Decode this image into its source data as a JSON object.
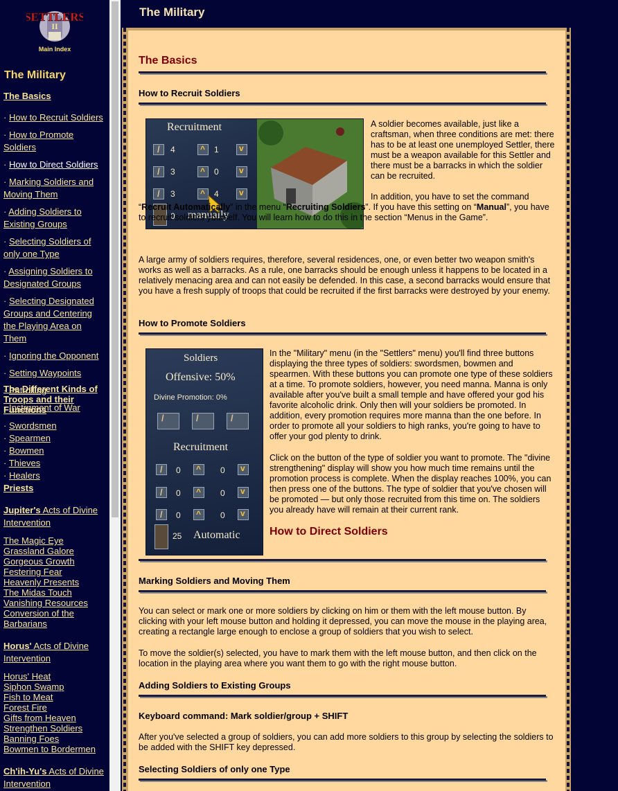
{
  "sidebar": {
    "logo_caption": "Main Index",
    "title": "The Military",
    "basics": "The Basics",
    "basics_items": [
      "How to Recruit Soldiers",
      "How to Promote Soldiers",
      "How to Direct Soldiers",
      "Marking Soldiers and Moving Them",
      "Adding Soldiers to Existing Groups",
      "Selecting Soldiers of only one Type",
      "Assigning Soldiers to Designated Groups",
      "Selecting Designated Groups and Centering the Playing Area on Them",
      "Ignoring the Opponent",
      "Setting Waypoints",
      "Patrolling",
      "Instrument of War"
    ],
    "kinds": "The Different Kinds of Troops and their Functions",
    "kinds_items": [
      "Swordsmen",
      "Spearmen",
      "Bowmen",
      "Thieves",
      "Healers"
    ],
    "priests": "Priests",
    "jupiter_bold": "Jupiter's",
    "jupiter_rest": " Acts of Divine Intervention",
    "jupiter_items": [
      "The Magic Eye",
      "Grassland Galore",
      "Gorgeous Growth",
      "Festering Fear",
      "Heavenly Presents",
      "The Midas Touch",
      "Vanishing Resources",
      "Conversion of the Barbarians"
    ],
    "horus_bold": "Horus'",
    "horus_rest": " Acts of Divine Intervention",
    "horus_items": [
      "Horus' Heat",
      "Siphon Swamp",
      "Fish to Meat",
      "Forest Fire",
      "Gifts from Heaven",
      "Strengthen Soldiers",
      "Banning Foes",
      "Bowmen to Bordermen"
    ],
    "chihyu_bold": "Ch'ih-Yu's",
    "chihyu_rest": " Acts of Divine Intervention"
  },
  "header": {
    "title": "The Military"
  },
  "main": {
    "basics_heading": "The Basics",
    "recruit_heading": "How to Recruit Soldiers",
    "recruit_p1": "A soldier becomes available, just like a craftsman, when three conditions are met: there has to be at least one unemployed Settler, there must be a weapon available for this Settler and there must be a barracks in which the soldier can be recruited.",
    "recruit_p2a": "In addition, you have to set the command “",
    "recruit_p2b": "Recruit Automatically",
    "recruit_p2c": "” in the menu “",
    "recruit_p2d": "Recruiting Soldiers",
    "recruit_p2e": "”. If you have this setting on “",
    "recruit_p2f": "Manual",
    "recruit_p2g": "”, you have to recruit soldiers yourself. You will learn how to do this in the section “Menus in the Game”.",
    "recruit_p3": "A large army of soldiers requires, therefore, several residences, one, or even better two weapon smith's works as well as a barracks. As a rule, one barracks should be enough unless it happens to be located in a relatively menacing area and can not easily be defended. In this case, a second barracks would ensure that you have a fresh supply of troops that could be recruited if the first barracks were destroyed by your enemy.",
    "promote_heading": "How to Promote Soldiers",
    "promote_p1": "In the \"Military\" menu (in the \"Settlers\" menu) you'll find three buttons displaying the three types of soldiers: swordsmen, bowmen and spearmen. With these buttons you can promote one type of these soldiers at a time. To promote soldiers, however, you need manna. Manna is only available after you've built a small temple and have offered your god his favorite alcoholic drink. Only then will your soldiers be promoted. In addition, every promotion requires more manna than the one before. In order to promote all your soldiers to high ranks, you're going to have to offer your god plenty to drink.",
    "promote_p2": "Click on the button of the type of soldier you want to promote. The \"divine strengthening\" display will show you how much time remains until the promotion process is complete. When the display reaches 100%, you can then press one of the buttons. The type of soldier that you've chosen will be promoted — but only those recruited from this time on. The soldiers you already have will remain at their current rank.",
    "direct_heading": "How to Direct Soldiers",
    "marking_heading": "Marking Soldiers and Moving Them",
    "marking_p1": "You can select or mark one or more soldiers by clicking on him or them with the left mouse button. By clicking with your left mouse button and holding it depressed, you can move the mouse in the playing area, creating a rectangle large enough to enclose a group of soldiers that you wish to select.",
    "marking_p2": "To move the soldier(s) selected, you have to mark them with the left mouse button, and then click on the location in the playing area where you want them to go with the right mouse button.",
    "adding_heading": "Adding Soldiers to Existing Groups",
    "keyboard_cmd": "Keyboard command: Mark soldier/group + SHIFT",
    "adding_p1": "After you've selected a group of soldiers, you can add more soldiers to this group by selecting the soldiers to be added with the SHIFT key depressed.",
    "selecting_heading": "Selecting Soldiers of only one Type"
  },
  "recruit_shot": {
    "title": "Recruitment",
    "rows": [
      [
        "4",
        "1"
      ],
      [
        "3",
        "0"
      ],
      [
        "3",
        "4"
      ]
    ],
    "settler_count": "0",
    "mode": "manually"
  },
  "promote_shot": {
    "title": "Soldiers",
    "offensive": "Offensive: 50%",
    "divine": "Divine Promotion: 0%",
    "recruitment": "Recruitment",
    "rows": [
      [
        "0",
        "0"
      ],
      [
        "0",
        "0"
      ],
      [
        "0",
        "0"
      ]
    ],
    "settler_count": "25",
    "mode": "Automatic"
  }
}
